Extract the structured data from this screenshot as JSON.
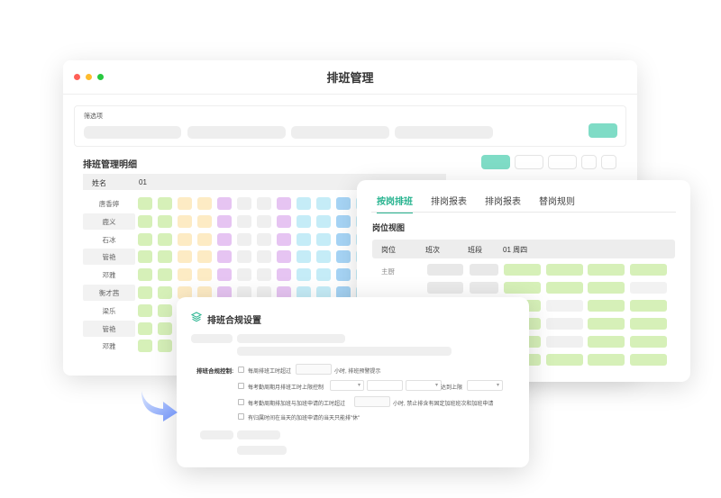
{
  "main_window": {
    "title": "排班管理",
    "traffic_lights": [
      "#ff5f57",
      "#febc2e",
      "#28c840"
    ],
    "filter": {
      "label": "筛选项"
    },
    "section_title": "排班管理明细",
    "table": {
      "col_name": "姓名",
      "col_day": "01",
      "rows": [
        "唐香婷",
        "鹿义",
        "石冰",
        "管艳",
        "邓雅",
        "衡才茜",
        "梁乐",
        "管艳",
        "邓雅"
      ]
    }
  },
  "right_window": {
    "tabs": [
      "按岗排班",
      "排岗报表",
      "排岗报表",
      "替岗规则"
    ],
    "subtitle": "岗位视图",
    "headers": [
      "岗位",
      "班次",
      "班段",
      "01 周四"
    ],
    "row_label": "主厨"
  },
  "dialog": {
    "title": "排班合规设置",
    "control_label": "排班合规控制:",
    "options": [
      "每周排班工时超过",
      "小时, 排班预警提示",
      "每考勤周期月排班工时上限控制",
      "达到上限",
      "每考勤周期排加班与加班申请的工时超过",
      "小时, 禁止排含有固定加班班次和加班申请",
      "有归属时间在当天的加班申请的当天只能排\"休\""
    ]
  },
  "colors": {
    "accent": "#27b38f",
    "green_button": "#7fdcc6",
    "shift_green": "#d6f0b8",
    "shift_yellow": "#fdebc4",
    "shift_purple": "#e6c4f2",
    "shift_cyan": "#c5ecf7",
    "shift_blue": "#a6d4f5",
    "shift_gray": "#efefef"
  }
}
